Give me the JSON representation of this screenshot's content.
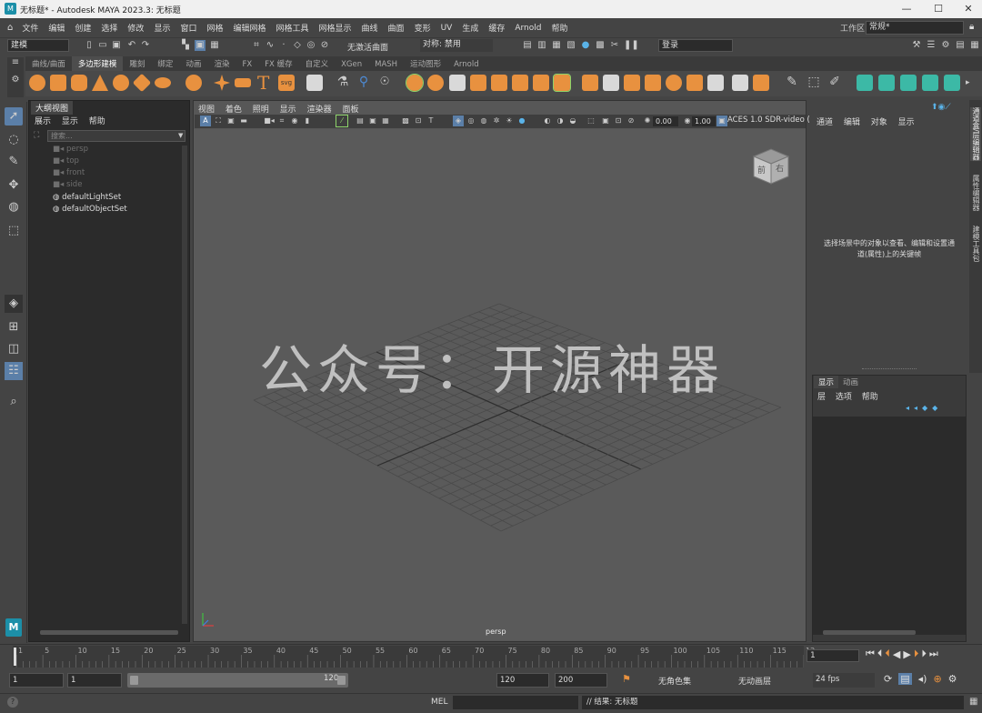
{
  "window": {
    "title": "无标题* - Autodesk MAYA 2023.3: 无标题",
    "app_icon": "M",
    "minimize": "—",
    "maximize": "☐",
    "close": "✕"
  },
  "menubar": {
    "items": [
      "文件",
      "编辑",
      "创建",
      "选择",
      "修改",
      "显示",
      "窗口",
      "网格",
      "编辑网格",
      "网格工具",
      "网格显示",
      "曲线",
      "曲面",
      "变形",
      "UV",
      "生成",
      "缓存",
      "Arnold",
      "帮助"
    ],
    "workspace_label": "工作区:",
    "workspace_value": "常规*"
  },
  "statusline": {
    "mode": "建模",
    "live_surface": "无激活曲面",
    "symmetry": "对称: 禁用",
    "login": "登录"
  },
  "shelf": {
    "tabs": [
      "曲线/曲面",
      "多边形建模",
      "雕刻",
      "绑定",
      "动画",
      "渲染",
      "FX",
      "FX 缓存",
      "自定义",
      "XGen",
      "MASH",
      "运动图形",
      "Arnold"
    ],
    "active_tab": "多边形建模"
  },
  "outliner": {
    "tab": "大纲视图",
    "menu": [
      "展示",
      "显示",
      "帮助"
    ],
    "search_placeholder": "搜索...",
    "cameras": [
      "persp",
      "top",
      "front",
      "side"
    ],
    "sets": [
      "defaultLightSet",
      "defaultObjectSet"
    ]
  },
  "viewport": {
    "menu": [
      "视图",
      "着色",
      "照明",
      "显示",
      "渲染器",
      "面板"
    ],
    "exposure": "0.00",
    "gamma": "1.00",
    "color_space": "ACES 1.0 SDR-video (",
    "camera_label": "persp",
    "viewcube_front": "前",
    "viewcube_right": "右",
    "watermark": "公众号：开源神器"
  },
  "channel_box": {
    "menu": [
      "通道",
      "编辑",
      "对象",
      "显示"
    ],
    "hint": "选择场景中的对象以查看、编辑和设置通道(属性)上的关键帧"
  },
  "layer_editor": {
    "tabs": [
      "显示",
      "动画"
    ],
    "menu": [
      "层",
      "选项",
      "帮助"
    ]
  },
  "side_tabs": [
    "通道盒/层编辑器",
    "属性编辑器",
    "建模工具包"
  ],
  "time_slider": {
    "ticks": [
      "1",
      "5",
      "10",
      "15",
      "20",
      "25",
      "30",
      "35",
      "40",
      "45",
      "50",
      "55",
      "60",
      "65",
      "70",
      "75",
      "80",
      "85",
      "90",
      "95",
      "100",
      "105",
      "110",
      "115",
      "12"
    ],
    "current_frame": "1"
  },
  "range_slider": {
    "start": "1",
    "playback_start": "1",
    "range_end_label": "120",
    "playback_end": "120",
    "end": "200",
    "character_set": "无角色集",
    "anim_layer": "无动画层",
    "fps": "24 fps"
  },
  "command_line": {
    "language": "MEL",
    "result": "// 结果: 无标题"
  }
}
